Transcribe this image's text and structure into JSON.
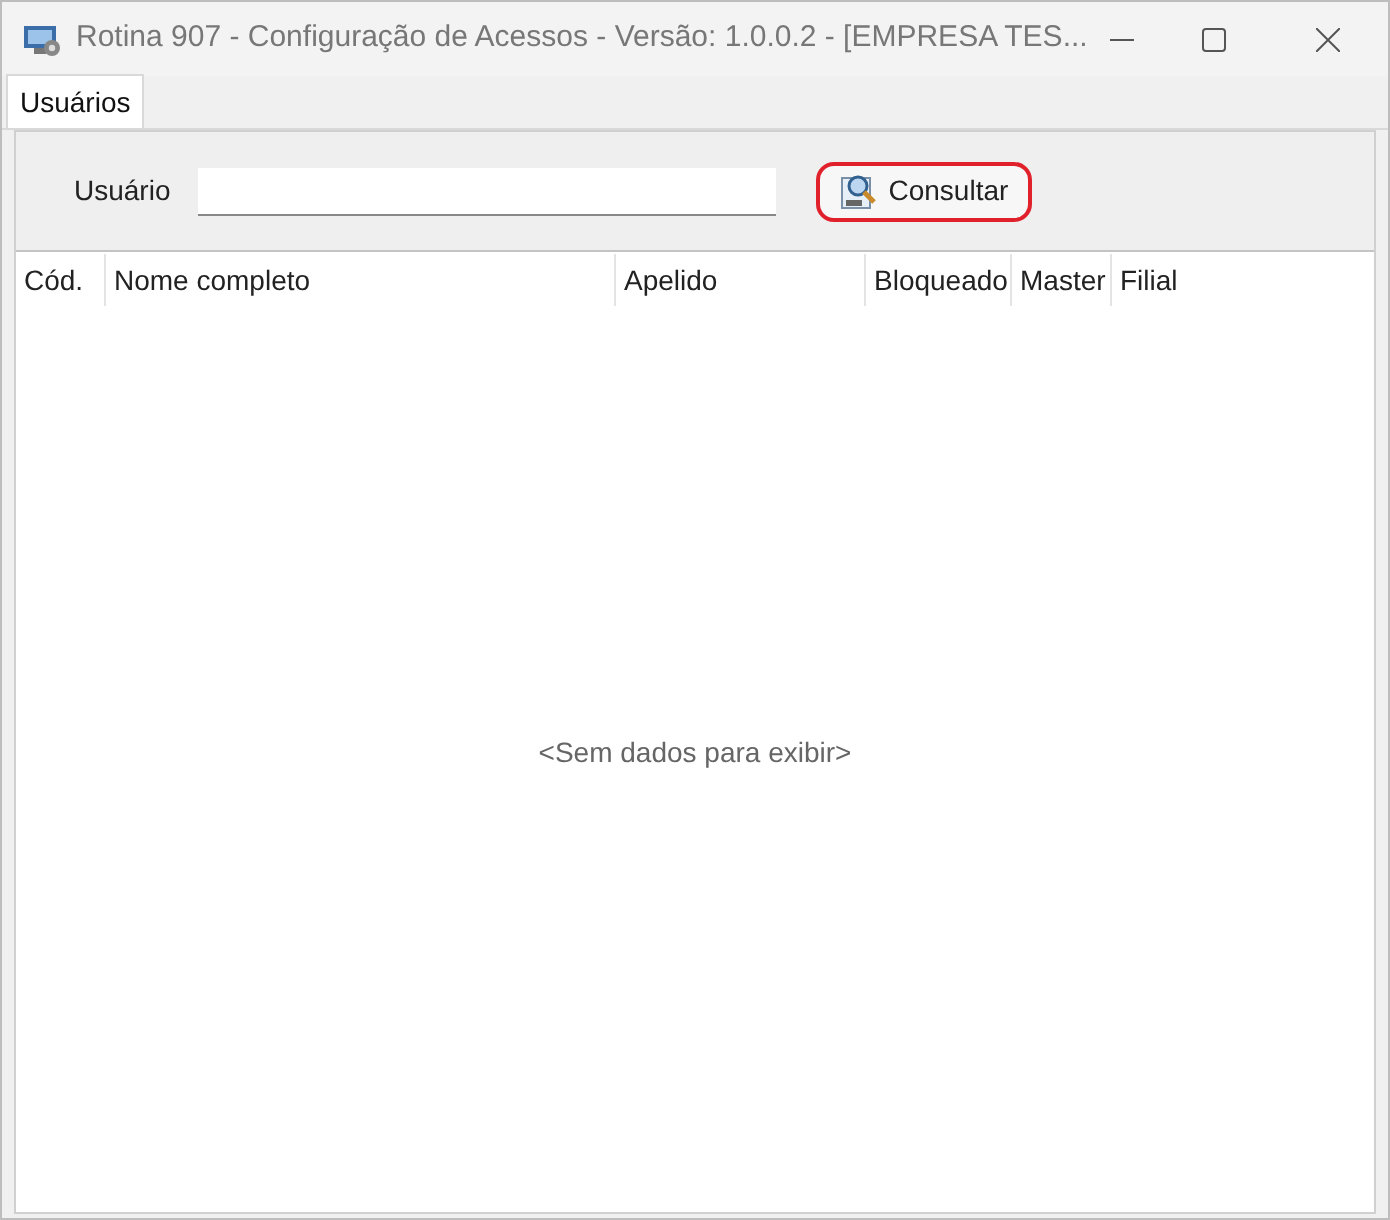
{
  "window": {
    "title": "Rotina 907 - Configuração de Acessos - Versão: 1.0.0.2 - [EMPRESA TES..."
  },
  "tabs": [
    {
      "label": "Usuários",
      "selected": true
    }
  ],
  "filter": {
    "label": "Usuário",
    "button": {
      "label": "Consultar",
      "highlighted": true
    }
  },
  "table": {
    "columns": [
      {
        "label": "Cód."
      },
      {
        "label": "Nome completo"
      },
      {
        "label": "Apelido"
      },
      {
        "label": "Bloqueado"
      },
      {
        "label": "Master"
      },
      {
        "label": "Filial"
      }
    ],
    "empty_message": "<Sem dados para exibir>"
  }
}
